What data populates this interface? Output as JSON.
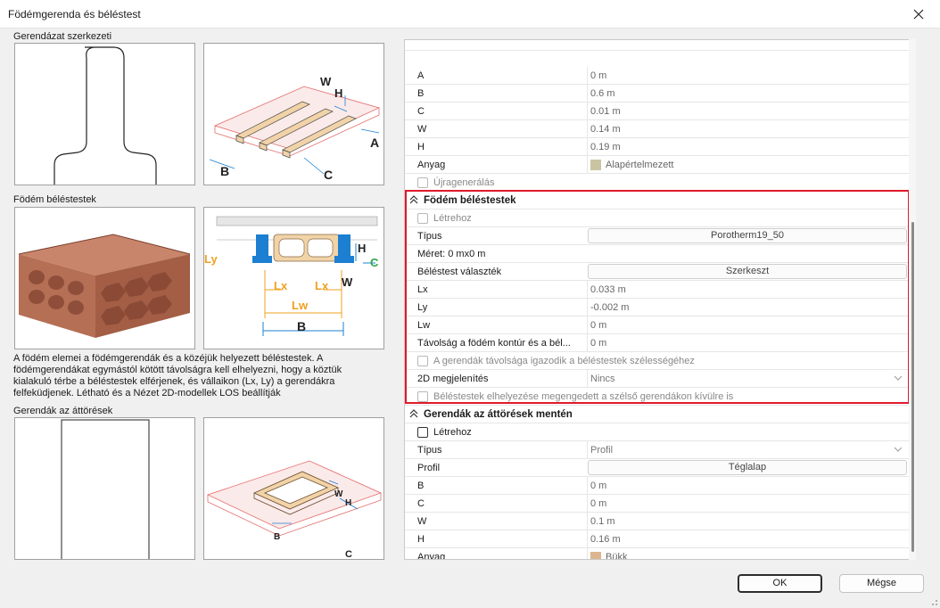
{
  "window": {
    "title": "Födémgerenda és béléstest",
    "close_icon": "close-icon"
  },
  "left": {
    "section_beams": "Gerendázat szerkezeti",
    "section_blocks": "Födém béléstestek",
    "section_openings": "Gerendák az áttörések",
    "beam_labels": {
      "w": "W",
      "h": "H",
      "a": "A",
      "b": "B",
      "c": "C"
    },
    "block_labels": {
      "ly": "Ly",
      "lx1": "Lx",
      "lx2": "Lx",
      "lw": "Lw",
      "b": "B",
      "h": "H",
      "c": "C",
      "w": "W"
    },
    "opening_labels": {
      "w": "W",
      "h": "H",
      "b": "B",
      "c": "C"
    },
    "description": "A födém elemei a födémgerendák és a közéjük helyezett béléstestek. A födémgerendákat egymástól kötött távolságra kell elhelyezni, hogy a köztük kialakuló térbe a béléstestek elférjenek, és vállaikon (Lx, Ly) a gerendákra felfeküdjenek. Létható és a Nézet 2D-modellek LOS beállítják"
  },
  "panel": {
    "rows_top": [
      {
        "label": "A",
        "value": "0 m"
      },
      {
        "label": "B",
        "value": "0.6 m"
      },
      {
        "label": "C",
        "value": "0.01 m"
      },
      {
        "label": "W",
        "value": "0.14 m"
      },
      {
        "label": "H",
        "value": "0.19 m"
      }
    ],
    "material_top": {
      "label": "Anyag",
      "value": "Alapértelmezett",
      "color": "#c9c5a3"
    },
    "regen": {
      "label": "Újragenerálás"
    },
    "blocks_section": {
      "title": "Födém béléstestek",
      "create": "Létrehoz",
      "type_label": "Típus",
      "type_value": "Porotherm19_50",
      "size_text": "Méret: 0 mx0 m",
      "selection_label": "Béléstest választék",
      "selection_button": "Szerkeszt",
      "lx": {
        "label": "Lx",
        "value": "0.033 m"
      },
      "ly": {
        "label": "Ly",
        "value": "-0.002 m"
      },
      "lw": {
        "label": "Lw",
        "value": "0 m"
      },
      "contour": {
        "label": "Távolság a födém kontúr és a bél...",
        "value": "0 m"
      },
      "adjust": "A gerendák távolsága igazodik a béléstestek szélességéhez",
      "view2d_label": "2D megjelenítés",
      "view2d_value": "Nincs",
      "outside": "Béléstestek elhelyezése megengedett a szélső gerendákon kívülre is"
    },
    "openings_section": {
      "title": "Gerendák az áttörések mentén",
      "create": "Létrehoz",
      "type_label": "Típus",
      "type_value": "Profil",
      "profile_label": "Profil",
      "profile_button": "Téglalap",
      "b": {
        "label": "B",
        "value": "0 m"
      },
      "c": {
        "label": "C",
        "value": "0 m"
      },
      "w": {
        "label": "W",
        "value": "0.1 m"
      },
      "h": {
        "label": "H",
        "value": "0.16 m"
      },
      "material": {
        "label": "Anyag",
        "value": "Bükk",
        "color": "#dcb58e"
      }
    }
  },
  "buttons": {
    "ok": "OK",
    "cancel": "Mégse"
  },
  "colors": {
    "highlight": "#e0192b",
    "wood": "#f1d3a8",
    "brick": "#b56f55",
    "blue": "#1c7fd1"
  }
}
